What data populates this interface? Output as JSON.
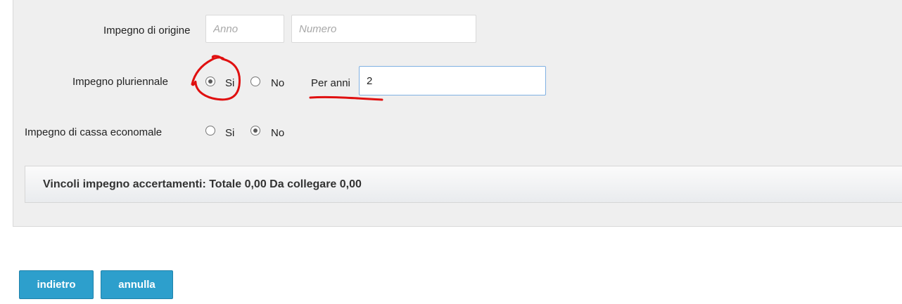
{
  "form": {
    "impegno_origine": {
      "label": "Impegno di origine",
      "anno_placeholder": "Anno",
      "numero_placeholder": "Numero"
    },
    "impegno_pluriennale": {
      "label": "Impegno pluriennale",
      "option_si": "Si",
      "option_no": "No",
      "selected": "Si",
      "per_anni_label": "Per anni",
      "per_anni_value": "2"
    },
    "impegno_cassa": {
      "label": "Impegno di cassa economale",
      "option_si": "Si",
      "option_no": "No",
      "selected": "No"
    }
  },
  "vincoli": {
    "title": "Vincoli impegno accertamenti: Totale 0,00 Da collegare 0,00"
  },
  "buttons": {
    "back_label": "indietro",
    "cancel_label": "annulla"
  },
  "colors": {
    "button": "#2d9fcc",
    "annotation": "#e01010"
  }
}
